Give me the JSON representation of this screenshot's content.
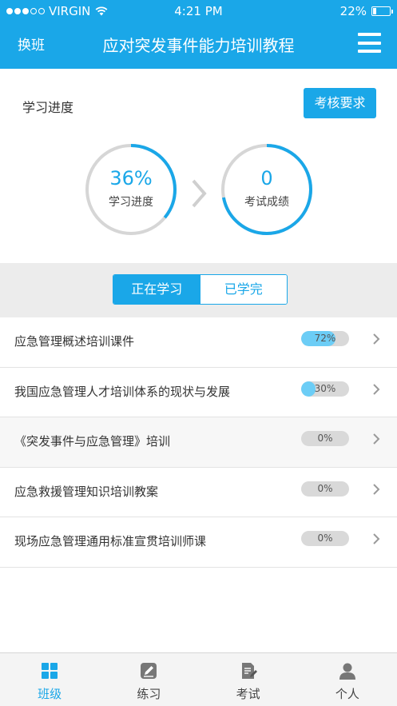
{
  "status_bar": {
    "carrier": "VIRGIN",
    "time": "4:21 PM",
    "battery_text": "22%",
    "battery_level": 0.22,
    "signal_bars_filled": 3,
    "signal_bars_total": 5
  },
  "navbar": {
    "left_label": "换班",
    "title": "应对突发事件能力培训教程",
    "menu_icon": "hamburger-menu-icon"
  },
  "progress": {
    "section_label": "学习进度",
    "requirements_button": "考核要求",
    "study_value": "36%",
    "study_fraction": 0.36,
    "study_label": "学习进度",
    "exam_value": "0",
    "exam_fraction": 0.72,
    "exam_label": "考试成绩"
  },
  "tabs": {
    "active": "正在学习",
    "inactive": "已学完"
  },
  "courses": [
    {
      "title": "应急管理概述培训课件",
      "progress_text": "72%",
      "progress": 0.72
    },
    {
      "title": "我国应急管理人才培训体系的现状与发展",
      "progress_text": "30%",
      "progress": 0.3
    },
    {
      "title": "《突发事件与应急管理》培训",
      "progress_text": "0%",
      "progress": 0
    },
    {
      "title": "应急救援管理知识培训教案",
      "progress_text": "0%",
      "progress": 0
    },
    {
      "title": "现场应急管理通用标准宣贯培训师课",
      "progress_text": "0%",
      "progress": 0
    }
  ],
  "tabbar": {
    "items": [
      {
        "label": "班级",
        "icon": "grid-icon",
        "active": true
      },
      {
        "label": "练习",
        "icon": "edit-note-icon",
        "active": false
      },
      {
        "label": "考试",
        "icon": "exam-paper-icon",
        "active": false
      },
      {
        "label": "个人",
        "icon": "person-icon",
        "active": false
      }
    ]
  },
  "colors": {
    "accent": "#1aa7e8",
    "pill_fill": "#6ccdf6",
    "ring_track": "#d6d6d6",
    "background_band": "#ececec"
  }
}
